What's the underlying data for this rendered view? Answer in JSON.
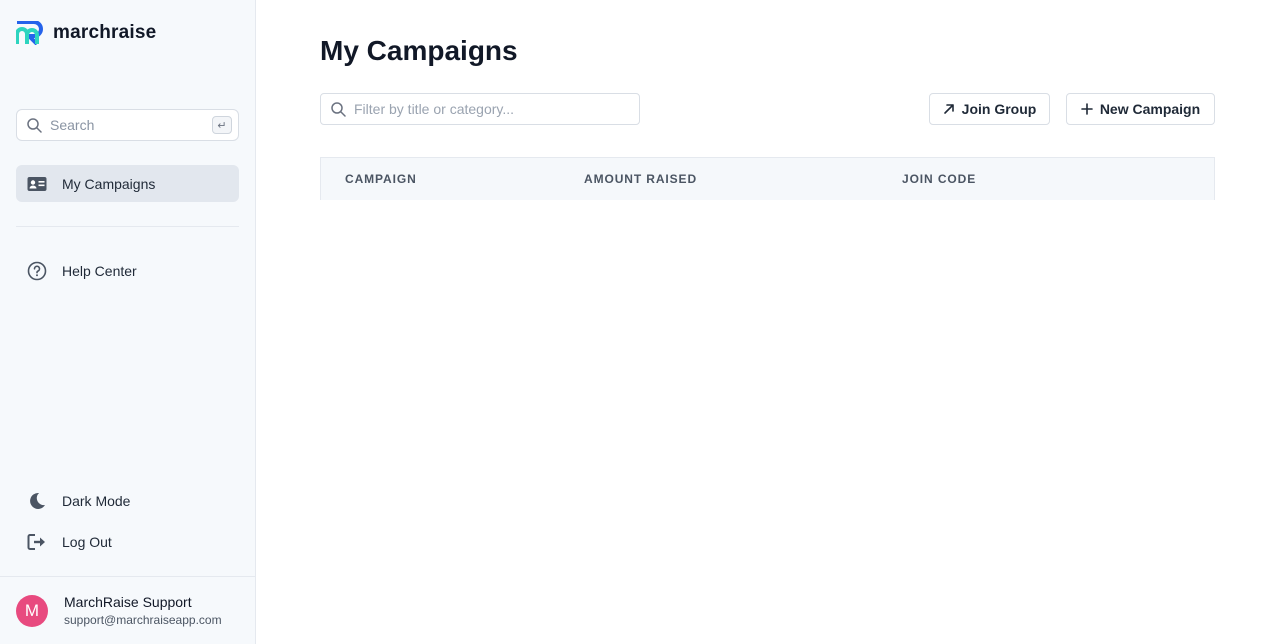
{
  "brand": {
    "name": "marchraise"
  },
  "sidebar": {
    "search": {
      "placeholder": "Search",
      "shortcut": "↵"
    },
    "items": [
      {
        "label": "My Campaigns",
        "icon": "id-card-icon",
        "active": true
      },
      {
        "label": "Help Center",
        "icon": "help-circle-icon",
        "active": false
      }
    ],
    "bottom_items": [
      {
        "label": "Dark Mode",
        "icon": "moon-icon"
      },
      {
        "label": "Log Out",
        "icon": "logout-icon"
      }
    ],
    "user": {
      "initial": "M",
      "name": "MarchRaise Support",
      "email": "support@marchraiseapp.com",
      "avatar_color": "#e84a7f"
    }
  },
  "main": {
    "title": "My Campaigns",
    "filter": {
      "placeholder": "Filter by title or category..."
    },
    "buttons": {
      "join_group": "Join Group",
      "new_campaign": "New Campaign"
    },
    "table": {
      "columns": [
        "CAMPAIGN",
        "AMOUNT RAISED",
        "JOIN CODE"
      ],
      "rows": []
    }
  },
  "colors": {
    "brand_blue": "#2563eb",
    "brand_teal": "#2dd4bf",
    "active_bg": "#e2e7ee"
  }
}
